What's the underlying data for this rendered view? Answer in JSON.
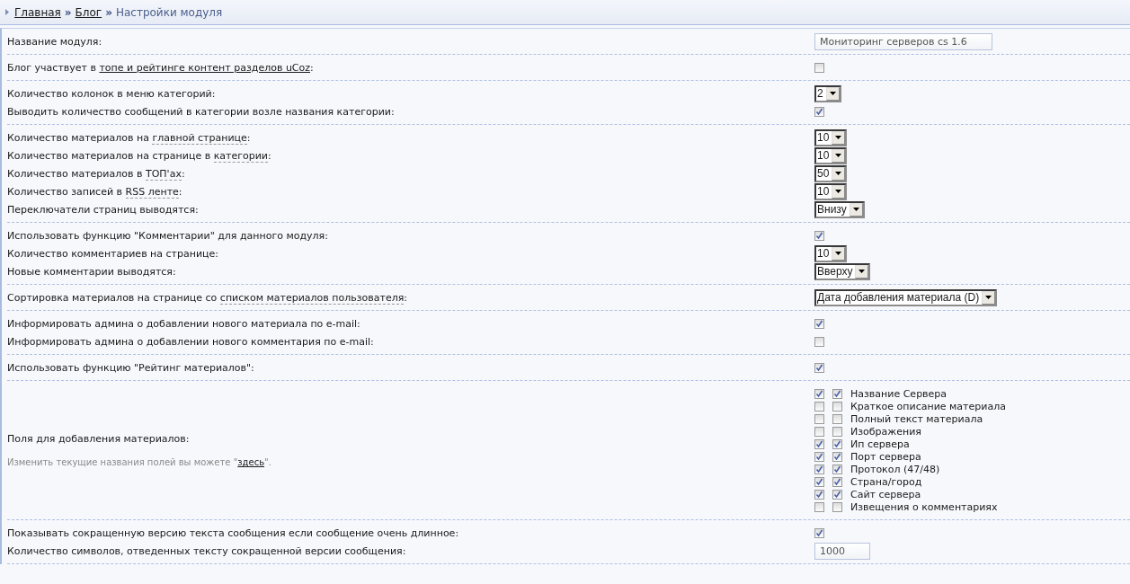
{
  "breadcrumb": {
    "separator": "»",
    "items": [
      {
        "text": "Главная",
        "kind": "link"
      },
      {
        "text": "Блог",
        "kind": "link"
      },
      {
        "text": "Настройки модуля",
        "kind": "current"
      }
    ]
  },
  "groups": [
    {
      "rows": [
        {
          "kind": "text",
          "label": [
            {
              "text": "Название модуля:"
            }
          ],
          "value": "Мониторинг серверов cs 1.6"
        }
      ]
    },
    {
      "rows": [
        {
          "kind": "checkbox",
          "label": [
            {
              "text": "Блог участвует в "
            },
            {
              "text": "топе и рейтинге контент разделов uCoz",
              "kind": "link"
            },
            {
              "text": ":"
            }
          ],
          "checked": false
        }
      ]
    },
    {
      "rows": [
        {
          "kind": "select",
          "label": [
            {
              "text": "Количество колонок в меню категорий:"
            }
          ],
          "value": "2"
        },
        {
          "kind": "checkbox",
          "label": [
            {
              "text": "Выводить количество сообщений в категории возле названия категории:"
            }
          ],
          "checked": true
        }
      ]
    },
    {
      "rows": [
        {
          "kind": "select",
          "label": [
            {
              "text": "Количество материалов на "
            },
            {
              "text": "главной странице",
              "kind": "hint"
            },
            {
              "text": ":"
            }
          ],
          "value": "10"
        },
        {
          "kind": "select",
          "label": [
            {
              "text": "Количество материалов на странице в "
            },
            {
              "text": "категории",
              "kind": "hint"
            },
            {
              "text": ":"
            }
          ],
          "value": "10"
        },
        {
          "kind": "select",
          "label": [
            {
              "text": "Количество материалов в "
            },
            {
              "text": "ТОП'ах",
              "kind": "hint"
            },
            {
              "text": ":"
            }
          ],
          "value": "50"
        },
        {
          "kind": "select",
          "label": [
            {
              "text": "Количество записей в "
            },
            {
              "text": "RSS ленте",
              "kind": "hint"
            },
            {
              "text": ":"
            }
          ],
          "value": "10"
        },
        {
          "kind": "select",
          "label": [
            {
              "text": "Переключатели страниц выводятся:"
            }
          ],
          "value": "Внизу"
        }
      ]
    },
    {
      "rows": [
        {
          "kind": "checkbox",
          "label": [
            {
              "text": "Использовать функцию \"Комментарии\" для данного модуля:"
            }
          ],
          "checked": true
        },
        {
          "kind": "select",
          "label": [
            {
              "text": "Количество комментариев на странице:"
            }
          ],
          "value": "10"
        },
        {
          "kind": "select",
          "label": [
            {
              "text": "Новые комментарии выводятся:"
            }
          ],
          "value": "Вверху"
        }
      ]
    },
    {
      "rows": [
        {
          "kind": "select",
          "label": [
            {
              "text": "Сортировка материалов на странице со "
            },
            {
              "text": "списком материалов пользователя",
              "kind": "hint"
            },
            {
              "text": ":"
            }
          ],
          "value": "Дата добавления материала (D)"
        }
      ]
    },
    {
      "rows": [
        {
          "kind": "checkbox",
          "label": [
            {
              "text": "Информировать админа о добавлении нового материала по e-mail:"
            }
          ],
          "checked": true
        },
        {
          "kind": "checkbox",
          "label": [
            {
              "text": "Информировать админа о добавлении нового комментария по e-mail:"
            }
          ],
          "checked": false
        }
      ]
    },
    {
      "rows": [
        {
          "kind": "checkbox",
          "label": [
            {
              "text": "Использовать функцию \"Рейтинг материалов\":"
            }
          ],
          "checked": true
        }
      ]
    },
    {
      "rows": [
        {
          "kind": "fields",
          "label": [
            {
              "text": "Поля для добавления материалов:"
            }
          ],
          "note": [
            {
              "text": "Изменить текущие названия полей вы можете \""
            },
            {
              "text": "здесь",
              "kind": "link"
            },
            {
              "text": "\"."
            }
          ],
          "fields": [
            {
              "name": "Название Сервера",
              "enabled": true,
              "required": true
            },
            {
              "name": "Краткое описание материала",
              "enabled": false,
              "required": false
            },
            {
              "name": "Полный текст материала",
              "enabled": false,
              "required": false
            },
            {
              "name": "Изображения",
              "enabled": false,
              "required": false
            },
            {
              "name": "Ип сервера",
              "enabled": true,
              "required": true
            },
            {
              "name": "Порт сервера",
              "enabled": true,
              "required": true
            },
            {
              "name": "Протокол (47/48)",
              "enabled": true,
              "required": true
            },
            {
              "name": "Страна/город",
              "enabled": true,
              "required": true
            },
            {
              "name": "Сайт сервера",
              "enabled": true,
              "required": true
            },
            {
              "name": "Извещения о комментариях",
              "enabled": false,
              "required": false
            }
          ]
        }
      ]
    },
    {
      "rows": [
        {
          "kind": "checkbox",
          "label": [
            {
              "text": "Показывать сокращенную версию текста сообщения если сообщение очень длинное:"
            }
          ],
          "checked": true
        },
        {
          "kind": "text",
          "label": [
            {
              "text": "Количество символов, отведенных тексту сокращенной версии сообщения:"
            }
          ],
          "value": "1000"
        }
      ]
    }
  ]
}
